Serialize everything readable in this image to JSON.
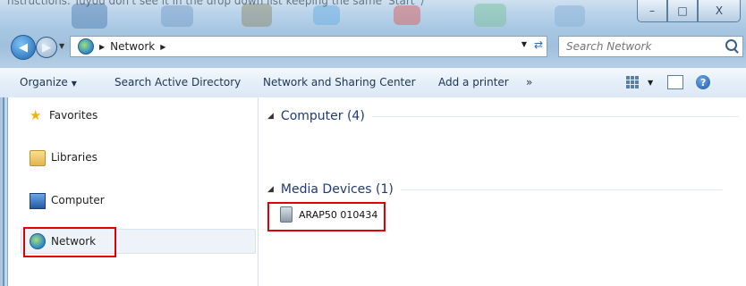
{
  "window": {
    "top_text": "nstructions. Tuyou don't see it in the drop down list keeping the same 'Start' /",
    "controls": {
      "minimize": "–",
      "maximize": "□",
      "close": "X"
    }
  },
  "address_bar": {
    "breadcrumb": [
      "Network"
    ]
  },
  "search": {
    "placeholder": "Search Network"
  },
  "toolbar": {
    "organize": "Organize",
    "search_ad": "Search Active Directory",
    "network_sharing": "Network and Sharing Center",
    "add_printer": "Add a printer",
    "more": "»"
  },
  "sidebar": {
    "items": [
      {
        "label": "Favorites",
        "icon": "star-icon"
      },
      {
        "label": "Libraries",
        "icon": "folder-icon"
      },
      {
        "label": "Computer",
        "icon": "computer-icon"
      },
      {
        "label": "Network",
        "icon": "network-icon",
        "selected": true
      }
    ]
  },
  "main": {
    "groups": [
      {
        "title": "Computer (4)"
      },
      {
        "title": "Media Devices (1)",
        "items": [
          {
            "label": "ARAP50 010434"
          }
        ]
      }
    ]
  },
  "colors": {
    "highlight": "#e10000",
    "group_title": "#1e3a7a"
  }
}
